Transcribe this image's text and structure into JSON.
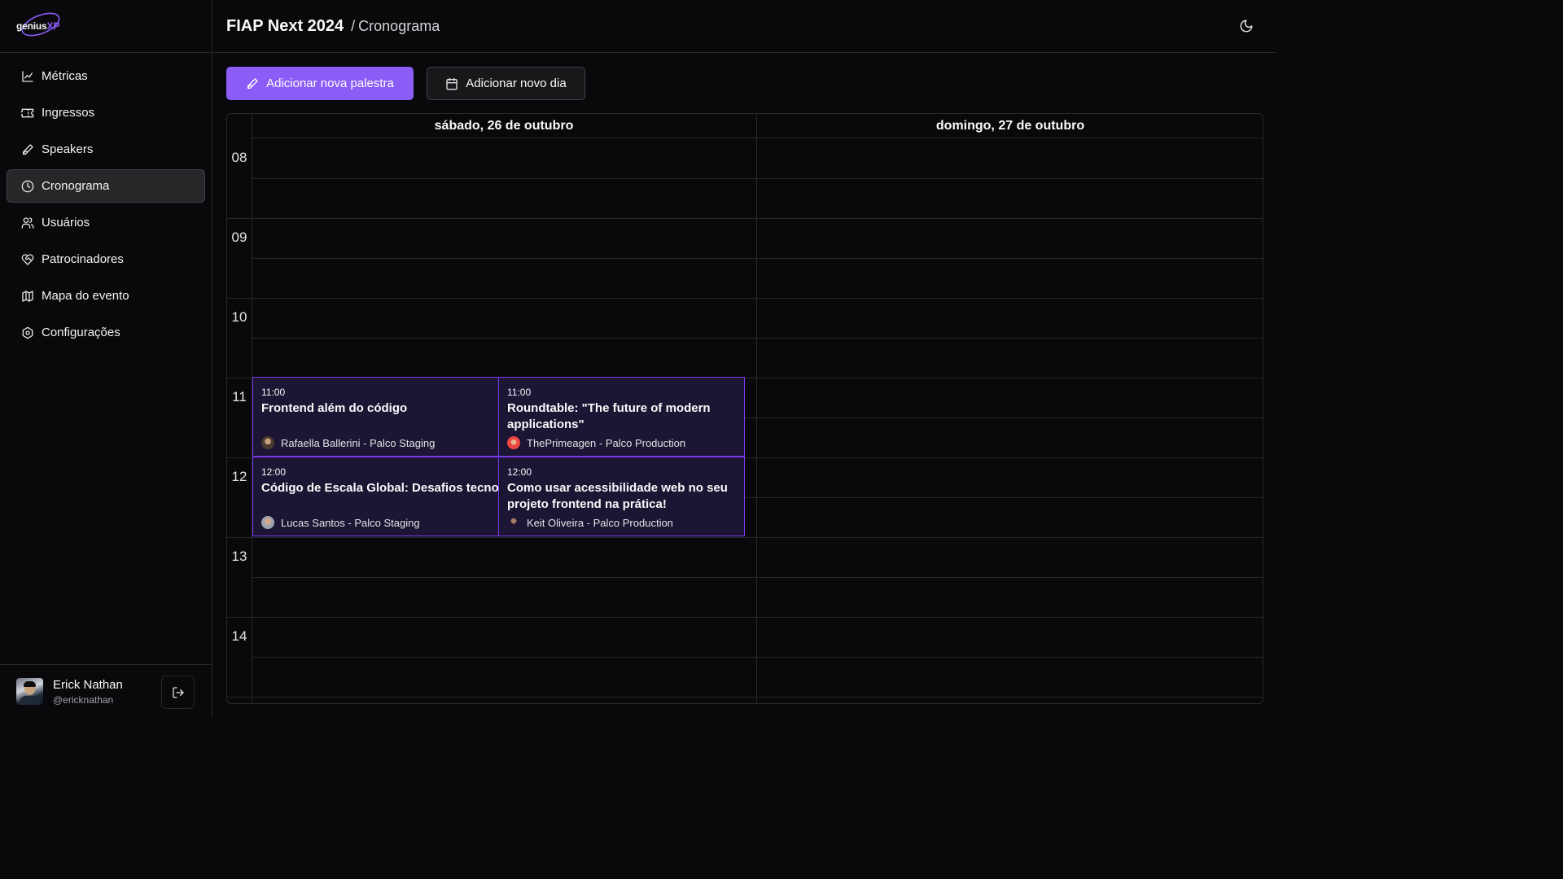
{
  "brand": {
    "word1": "genius",
    "word2": "XP",
    "accent": "#8b5cf6"
  },
  "sidebar": {
    "items": [
      {
        "label": "Métricas",
        "icon": "chart-line-icon",
        "active": false
      },
      {
        "label": "Ingressos",
        "icon": "ticket-icon",
        "active": false
      },
      {
        "label": "Speakers",
        "icon": "pen-icon",
        "active": false
      },
      {
        "label": "Cronograma",
        "icon": "clock-icon",
        "active": true
      },
      {
        "label": "Usuários",
        "icon": "users-icon",
        "active": false
      },
      {
        "label": "Patrocinadores",
        "icon": "heart-handshake-icon",
        "active": false
      },
      {
        "label": "Mapa do evento",
        "icon": "map-icon",
        "active": false
      },
      {
        "label": "Configurações",
        "icon": "settings-icon",
        "active": false
      }
    ],
    "user": {
      "name": "Erick Nathan",
      "handle": "@ericknathan"
    }
  },
  "header": {
    "title": "FIAP Next 2024",
    "separator": "/",
    "crumb": "Cronograma"
  },
  "toolbar": {
    "add_talk": "Adicionar nova palestra",
    "add_day": "Adicionar novo dia"
  },
  "calendar": {
    "days": [
      "sábado, 26 de outubro",
      "domingo, 27 de outubro"
    ],
    "hours": [
      "08",
      "09",
      "10",
      "11",
      "12",
      "13",
      "14"
    ],
    "events": [
      {
        "time": "11:00",
        "title": "Frontend além do código",
        "meta": "Rafaella Ballerini - Palco Staging"
      },
      {
        "time": "11:00",
        "title": "Roundtable: \"The future of modern applications\"",
        "meta": "ThePrimeagen - Palco Production"
      },
      {
        "time": "12:00",
        "title": "Código de Escala Global: Desafios tecno",
        "meta": "Lucas Santos - Palco Staging"
      },
      {
        "time": "12:00",
        "title": "Como usar acessibilidade web no seu projeto frontend na prática!",
        "meta": "Keit Oliveira - Palco Production"
      }
    ]
  }
}
